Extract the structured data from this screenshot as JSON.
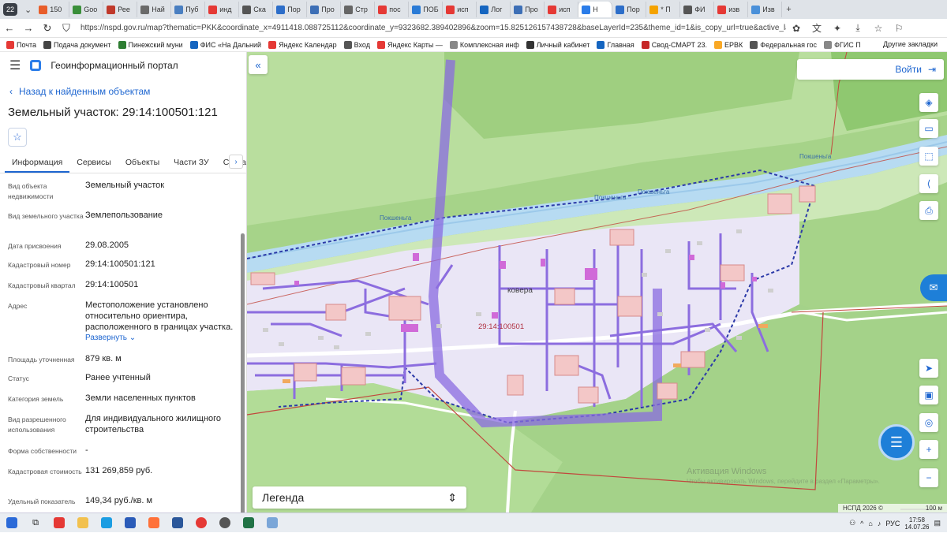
{
  "browser": {
    "tab_count": "22",
    "tabs": [
      {
        "label": "150",
        "color": "#e85d2a"
      },
      {
        "label": "Goo",
        "color": "#3a8f3a"
      },
      {
        "label": "Рее",
        "color": "#c0392b"
      },
      {
        "label": "Най",
        "color": "#6a6a6a"
      },
      {
        "label": "Пуб",
        "color": "#4a7fc1"
      },
      {
        "label": "инд",
        "color": "#e53935"
      },
      {
        "label": "Ска",
        "color": "#555555"
      },
      {
        "label": "Пор",
        "color": "#2d6ec9"
      },
      {
        "label": "Про",
        "color": "#3d6fb6"
      },
      {
        "label": "Стр",
        "color": "#666666"
      },
      {
        "label": "пос",
        "color": "#e53935"
      },
      {
        "label": "ПОБ",
        "color": "#2a7bd6"
      },
      {
        "label": "исп",
        "color": "#e53935"
      },
      {
        "label": "Лог",
        "color": "#1565c0"
      },
      {
        "label": "Про",
        "color": "#3d6fb6"
      },
      {
        "label": "исп",
        "color": "#e53935"
      },
      {
        "label": "Н",
        "color": "#2b7de9"
      },
      {
        "label": "Пор",
        "color": "#2d6ec9"
      },
      {
        "label": "* П",
        "color": "#f4a300"
      },
      {
        "label": "ФИ",
        "color": "#555555"
      },
      {
        "label": "изв",
        "color": "#e53935"
      },
      {
        "label": "Изв",
        "color": "#4a90d9"
      }
    ],
    "active_tab_index": 16,
    "url": "https://nspd.gov.ru/map?thematic=PKK&coordinate_x=4911418.088725112&coordinate_y=9323682.389402896&zoom=15.825126157438728&baseLayerId=235&theme_id=1&is_copy_url=true&active_lay...",
    "bookmarks": [
      {
        "label": "Почта",
        "color": "#e53935"
      },
      {
        "label": "Подача документ",
        "color": "#444444"
      },
      {
        "label": "Пинежский муни",
        "color": "#2e7d32"
      },
      {
        "label": "ФИС «На Дальний",
        "color": "#1565c0"
      },
      {
        "label": "Яндекс Календар",
        "color": "#e53935"
      },
      {
        "label": "Вход",
        "color": "#555555"
      },
      {
        "label": "Яндекс Карты —",
        "color": "#e53935"
      },
      {
        "label": "Комплексная инф",
        "color": "#888888"
      },
      {
        "label": "Личный кабинет",
        "color": "#333333"
      },
      {
        "label": "Главная",
        "color": "#1565c0"
      },
      {
        "label": "Свод-СМАРТ 23.",
        "color": "#c62828"
      },
      {
        "label": "ЕРВК",
        "color": "#f9a825"
      },
      {
        "label": "Федеральная гос",
        "color": "#555555"
      },
      {
        "label": "ФГИС П",
        "color": "#888888"
      }
    ],
    "other_bookmarks": "Другие закладки"
  },
  "portal": {
    "title": "Геоинформационный портал",
    "back_link": "Назад к найденным объектам",
    "object_title": "Земельный участок: 29:14:100501:121",
    "tabs": [
      "Информация",
      "Сервисы",
      "Объекты",
      "Части ЗУ",
      "Состав"
    ],
    "active_tab": 0,
    "properties": [
      {
        "key": "Вид объекта недвижимости",
        "value": "Земельный участок"
      },
      {
        "key": "Вид земельного участка",
        "value": "Землепользование"
      },
      {
        "key": "Дата присвоения",
        "value": "29.08.2005"
      },
      {
        "key": "Кадастровый номер",
        "value": "29:14:100501:121"
      },
      {
        "key": "Кадастровый квартал",
        "value": "29:14:100501"
      },
      {
        "key": "Адрес",
        "value": "Местоположение установлено относительно ориентира, расположенного в границах участка."
      },
      {
        "key": "Площадь уточненная",
        "value": "879 кв. м"
      },
      {
        "key": "Статус",
        "value": "Ранее учтенный"
      },
      {
        "key": "Категория земель",
        "value": "Земли населенных пунктов"
      },
      {
        "key": "Вид разрешенного использования",
        "value": "Для индивидуального жилищного строительства"
      },
      {
        "key": "Форма собственности",
        "value": "-"
      },
      {
        "key": "Кадастровая стоимость",
        "value": "131 269,859 руб."
      },
      {
        "key": "Удельный показатель",
        "value": "149,34 руб./кв. м"
      }
    ],
    "expand_label": "Развернуть"
  },
  "map": {
    "login_label": "Войти",
    "parcel_label": "29:14:100501",
    "place_label": "ковера",
    "river_labels": [
      "Покшеньга",
      "Покшеньга",
      "Покшеньга",
      "Покшеньга"
    ],
    "legend_label": "Легенда",
    "copyright": "НСПД 2026 ©",
    "scale_label": "100 м",
    "watermark": "Активация Windows",
    "watermark_sub": "Чтобы активировать Windows, перейдите в раздел «Параметры»."
  },
  "taskbar": {
    "language": "РУС",
    "time": "17:58",
    "date": "14.07.26"
  }
}
